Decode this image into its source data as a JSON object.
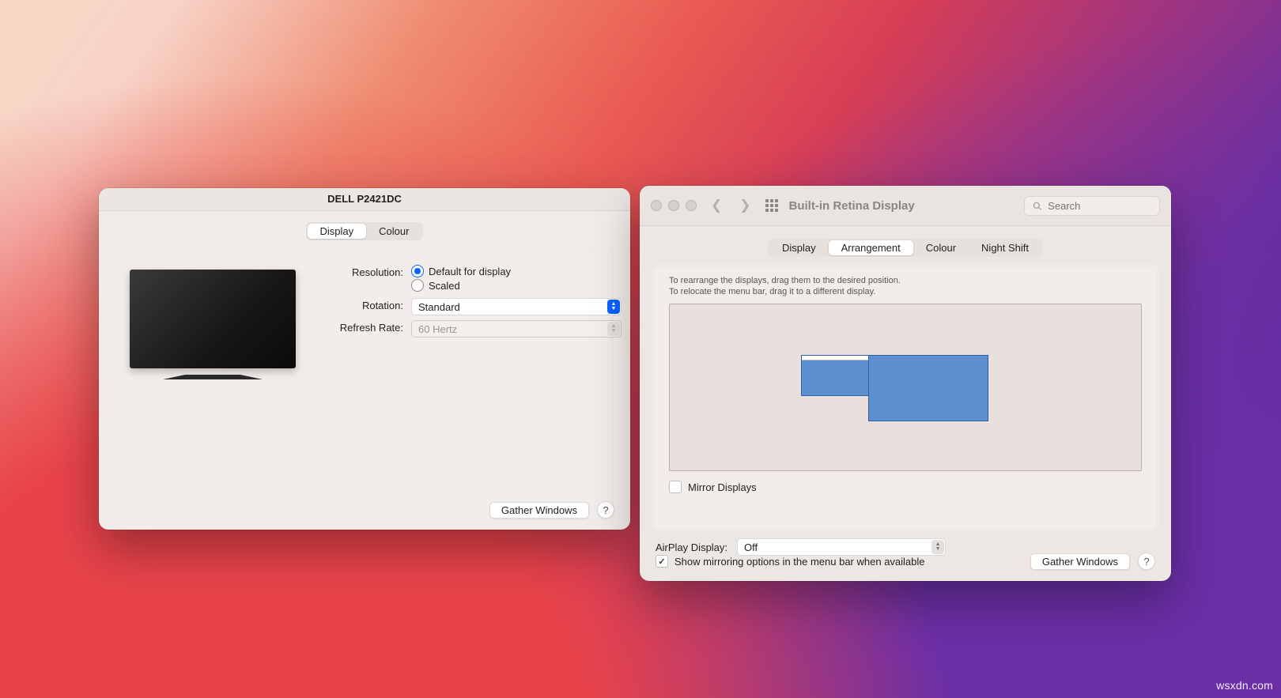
{
  "watermark": "wsxdn.com",
  "win1": {
    "title": "DELL P2421DC",
    "tabs": [
      "Display",
      "Colour"
    ],
    "active_tab": 0,
    "resolution_label": "Resolution:",
    "resolution_default": "Default for display",
    "resolution_scaled": "Scaled",
    "rotation_label": "Rotation:",
    "rotation_value": "Standard",
    "refresh_label": "Refresh Rate:",
    "refresh_value": "60 Hertz",
    "gather_button": "Gather Windows",
    "help": "?"
  },
  "win2": {
    "title": "Built-in Retina Display",
    "search_placeholder": "Search",
    "tabs": [
      "Display",
      "Arrangement",
      "Colour",
      "Night Shift"
    ],
    "active_tab": 1,
    "help_line1": "To rearrange the displays, drag them to the desired position.",
    "help_line2": "To relocate the menu bar, drag it to a different display.",
    "mirror_label": "Mirror Displays",
    "mirror_checked": false,
    "airplay_label": "AirPlay Display:",
    "airplay_value": "Off",
    "show_mirror_label": "Show mirroring options in the menu bar when available",
    "show_mirror_checked": true,
    "gather_button": "Gather Windows",
    "help": "?"
  }
}
